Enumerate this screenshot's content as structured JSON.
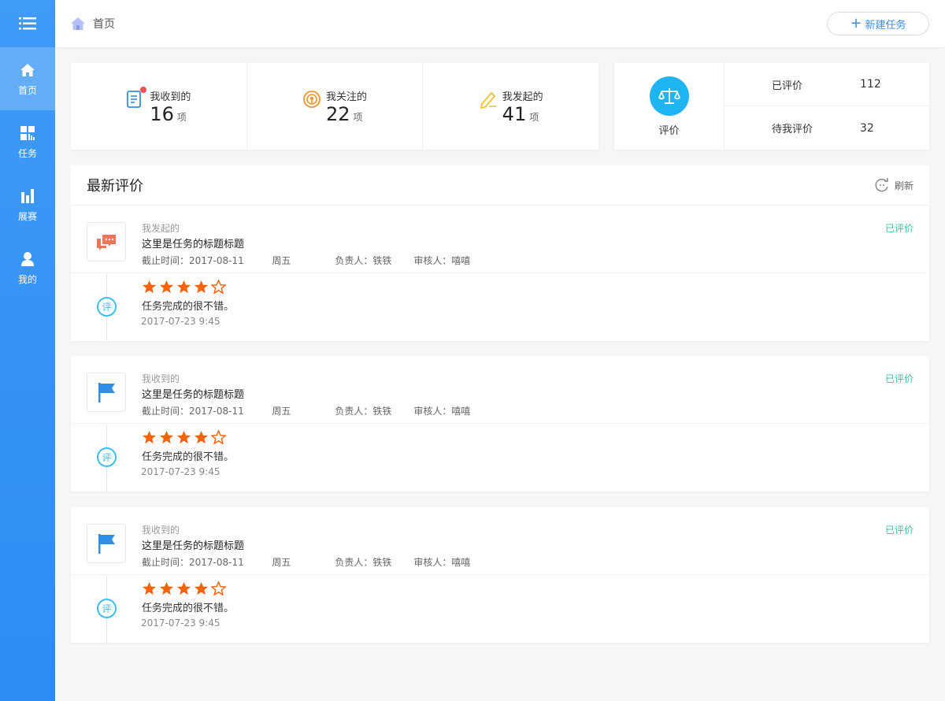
{
  "sidebar": {
    "items": [
      {
        "label": "首页",
        "icon": "home-icon"
      },
      {
        "label": "任务",
        "icon": "grid-icon"
      },
      {
        "label": "展赛",
        "icon": "bar-chart-icon"
      },
      {
        "label": "我的",
        "icon": "user-icon"
      }
    ]
  },
  "header": {
    "breadcrumb": "首页",
    "new_task_label": "新建任务"
  },
  "stats": [
    {
      "label": "我收到的",
      "value": "16",
      "unit": "项"
    },
    {
      "label": "我关注的",
      "value": "22",
      "unit": "项"
    },
    {
      "label": "我发起的",
      "value": "41",
      "unit": "项"
    }
  ],
  "evaluation": {
    "label": "评价",
    "rows": [
      {
        "label": "已评价",
        "value": "112"
      },
      {
        "label": "待我评价",
        "value": "32"
      }
    ]
  },
  "latest": {
    "title": "最新评价",
    "refresh_label": "刷新"
  },
  "cards": [
    {
      "type": "我发起的",
      "title": "这里是任务的标题标题",
      "deadline": "截止时间：2017-08-11",
      "weekday": "周五",
      "owner": "负责人：铁铁",
      "reviewer": "审核人：嘻嘻",
      "status": "已评价",
      "badge": "评",
      "rating": 4,
      "comment": "任务完成的很不错。",
      "date": "2017-07-23 9:45"
    },
    {
      "type": "我收到的",
      "title": "这里是任务的标题标题",
      "deadline": "截止时间：2017-08-11",
      "weekday": "周五",
      "owner": "负责人：铁铁",
      "reviewer": "审核人：嘻嘻",
      "status": "已评价",
      "badge": "评",
      "rating": 4,
      "comment": "任务完成的很不错。",
      "date": "2017-07-23 9:45"
    },
    {
      "type": "我收到的",
      "title": "这里是任务的标题标题",
      "deadline": "截止时间：2017-08-11",
      "weekday": "周五",
      "owner": "负责人：铁铁",
      "reviewer": "审核人：嘻嘻",
      "status": "已评价",
      "badge": "评",
      "rating": 4,
      "comment": "任务完成的很不错。",
      "date": "2017-07-23 9:45"
    }
  ],
  "colors": {
    "sidebar": "#3f9bf6",
    "accent": "#3a8ee6",
    "status": "#36c5a0",
    "star": "#f5630a",
    "eval_circle": "#1fb5f2"
  }
}
